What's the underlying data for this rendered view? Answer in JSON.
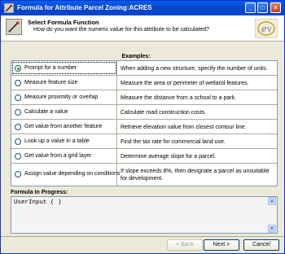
{
  "window": {
    "title": "Formula for Attribute Parcel Zoning:ACRES"
  },
  "header": {
    "title": "Select Formula Function",
    "subtitle": "How do you want the numeric value for this attribute to be calculated?"
  },
  "examples_label": "Examples:",
  "options": [
    {
      "label": "Prompt for a number",
      "example": "When adding a new structure, specify the number of units.",
      "checked": true
    },
    {
      "label": "Measure feature size",
      "example": "Measure the area or perimeter of wetland features.",
      "checked": false
    },
    {
      "label": "Measure proximity or overlap",
      "example": "Measure the distance from a school to a park.",
      "checked": false
    },
    {
      "label": "Calculate a value",
      "example": "Calculate road construction costs.",
      "checked": false
    },
    {
      "label": "Get value from another feature",
      "example": "Retrieve elevation value from closest contour line.",
      "checked": false
    },
    {
      "label": "Look up a value in a table",
      "example": "Find the tax rate for commercial land use.",
      "checked": false
    },
    {
      "label": "Get value from a grid layer",
      "example": "Determine average slope for a parcel.",
      "checked": false
    },
    {
      "label": "Assign value depending on conditions",
      "example": "If slope exceeds 8%, then designate a parcel as unsuitable for development.",
      "checked": false
    }
  ],
  "formula": {
    "label": "Formula In Progress:",
    "value": "UserInput ( )"
  },
  "buttons": {
    "back": "< Back",
    "next": "Next >",
    "cancel": "Cancel"
  },
  "colors": {
    "titlebar": "#0542c4",
    "window_bg": "#ece9d8",
    "selected_radio": "#21a121"
  }
}
